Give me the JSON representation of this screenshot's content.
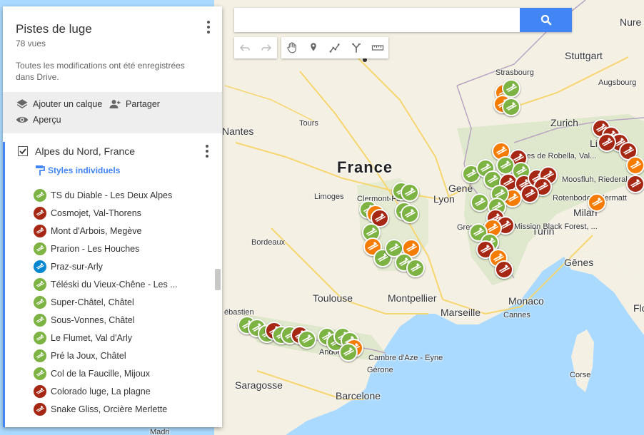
{
  "colors": {
    "green": "#7cb342",
    "red": "#a52714",
    "orange": "#f57c00",
    "blue": "#0288d1",
    "accent": "#4285f4"
  },
  "panel": {
    "title": "Pistes de luge",
    "views": "78 vues",
    "save_status": "Toutes les modifications ont été enregistrées dans Drive.",
    "actions": {
      "add_layer": "Ajouter un calque",
      "share": "Partager",
      "preview": "Aperçu"
    },
    "layer": {
      "name": "Alpes du Nord, France",
      "checked": true,
      "styles": "Styles individuels",
      "items": [
        {
          "label": "TS du Diable - Les Deux Alpes",
          "color": "green",
          "icon": "sled-icon"
        },
        {
          "label": "Cosmojet, Val-Thorens",
          "color": "red",
          "icon": "sled-icon"
        },
        {
          "label": "Mont d'Arbois, Megève",
          "color": "red",
          "icon": "sled-icon"
        },
        {
          "label": "Prarion - Les Houches",
          "color": "green",
          "icon": "sled-icon"
        },
        {
          "label": "Praz-sur-Arly",
          "color": "blue",
          "icon": "sled-icon"
        },
        {
          "label": "Téléski du Vieux-Chêne - Les ...",
          "color": "green",
          "icon": "sled-icon"
        },
        {
          "label": "Super-Châtel, Châtel",
          "color": "green",
          "icon": "sled-icon"
        },
        {
          "label": "Sous-Vonnes, Châtel",
          "color": "green",
          "icon": "sled-icon"
        },
        {
          "label": "Le Flumet, Val d'Arly",
          "color": "green",
          "icon": "sled-icon"
        },
        {
          "label": "Pré la Joux,  Châtel",
          "color": "green",
          "icon": "sled-icon"
        },
        {
          "label": "Col de la Faucille, Mijoux",
          "color": "green",
          "icon": "sled-icon"
        },
        {
          "label": "Colorado luge, La plagne",
          "color": "red",
          "icon": "sled-icon"
        },
        {
          "label": "Snake Gliss, Orcière Merlette",
          "color": "red",
          "icon": "sled-icon"
        }
      ]
    }
  },
  "search": {
    "placeholder": ""
  },
  "toolbar": {
    "tools": [
      "undo-icon",
      "redo-icon",
      "hand-icon",
      "marker-icon",
      "draw-line-icon",
      "route-icon",
      "ruler-icon"
    ]
  },
  "map": {
    "country": "France",
    "cities": [
      "Nantes",
      "Tours",
      "Limoges",
      "Clermont-Fe",
      "Lyon",
      "Genè",
      "Grenoble",
      "Turin",
      "Milan",
      "Gênes",
      "Bordeaux",
      "Toulouse",
      "Montpellier",
      "Marseille",
      "Monaco",
      "Cannes",
      "Barcelone",
      "Saragosse",
      "Gérone",
      "Andorre",
      "Zurich",
      "Stuttgart",
      "Strasbourg",
      "Augsbourg",
      "Nure",
      "Corse",
      "Flo",
      "ébastien",
      "Rotenboden, Zermatt",
      "Moosfluh, Riederalp",
      "Buttes de Robella, Val...",
      "Mission Black Forest, ...",
      "Cambre d'Aze - Eyne",
      "Madri",
      "Lie"
    ],
    "markers": [
      {
        "color": "green"
      },
      {
        "color": "orange"
      },
      {
        "color": "red"
      }
    ]
  }
}
